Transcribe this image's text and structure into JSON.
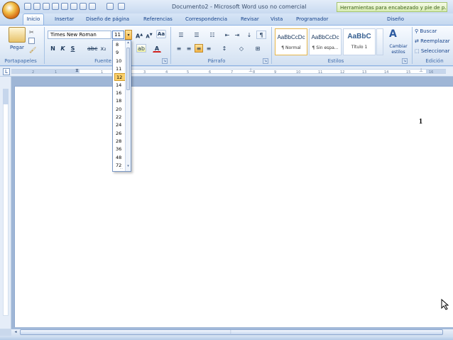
{
  "window": {
    "title": "Documento2 - Microsoft Word uso no comercial",
    "context_tab_title": "Herramientas para encabezado y pie de p..."
  },
  "tabs": [
    {
      "label": "Inicio"
    },
    {
      "label": "Insertar"
    },
    {
      "label": "Diseño de página"
    },
    {
      "label": "Referencias"
    },
    {
      "label": "Correspondencia"
    },
    {
      "label": "Revisar"
    },
    {
      "label": "Vista"
    },
    {
      "label": "Programador"
    },
    {
      "label": "Diseño"
    }
  ],
  "clipboard": {
    "paste_label": "Pegar",
    "group_label": "Portapapeles"
  },
  "font": {
    "name": "Times New Roman",
    "size": "11",
    "group_label": "Fuente"
  },
  "paragraph": {
    "group_label": "Párrafo"
  },
  "styles": {
    "group_label": "Estilos",
    "items": [
      {
        "sample": "AaBbCcDc",
        "name": "¶ Normal"
      },
      {
        "sample": "AaBbCcDc",
        "name": "¶ Sin espa..."
      },
      {
        "sample": "AaBbC",
        "name": "Título 1"
      }
    ],
    "change_styles_label": "Cambiar estilos"
  },
  "editing": {
    "group_label": "Edición",
    "find_label": "Buscar",
    "replace_label": "Reemplazar",
    "select_label": "Seleccionar"
  },
  "font_size_dropdown": {
    "options": [
      "8",
      "9",
      "10",
      "11",
      "12",
      "14",
      "16",
      "18",
      "20",
      "22",
      "24",
      "26",
      "28",
      "36",
      "48",
      "72"
    ],
    "highlighted": "12"
  },
  "ruler": {
    "labels": [
      "2",
      "1",
      "1",
      "2",
      "3",
      "4",
      "5",
      "6",
      "7",
      "8",
      "9",
      "10",
      "11",
      "12",
      "13",
      "14",
      "15",
      "16"
    ]
  },
  "document": {
    "page_number": "1"
  },
  "colors": {
    "ribbon_bg": "#e1ebf7",
    "accent": "#15428b",
    "highlight": "#fbd06a",
    "workspace": "#9fb6d6"
  }
}
